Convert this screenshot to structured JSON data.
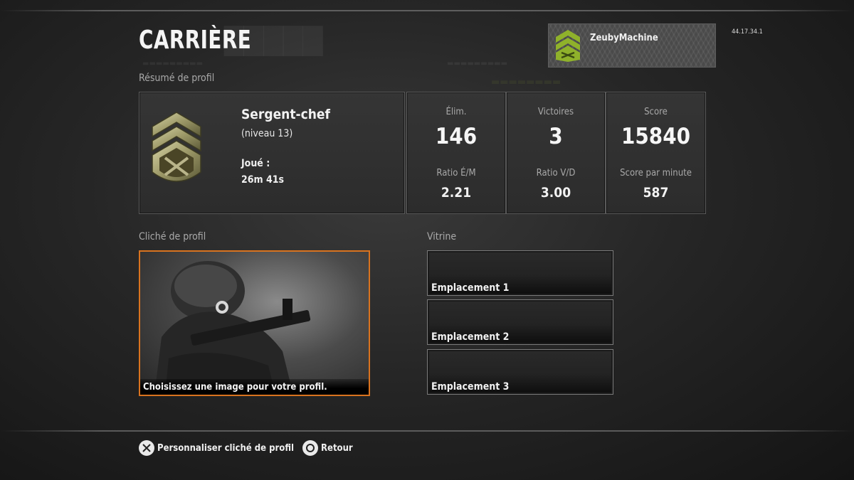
{
  "header": {
    "title": "CARRIÈRE",
    "version": "44.17.34.1"
  },
  "player": {
    "name": "ZeubyMachine",
    "emblem_icon": "sergeant-chevron-icon",
    "emblem_color": "#8fb12b"
  },
  "profile_summary": {
    "section_label": "Résumé de profil",
    "rank": {
      "icon": "staff-sergeant-rank-icon",
      "name": "Sergent-chef",
      "level": "(niveau 13)",
      "played_label": "Joué :",
      "played_value": "26m 41s"
    },
    "stats": [
      {
        "title": "Élim.",
        "value": "146",
        "sub_title": "Ratio É/M",
        "sub_value": "2.21"
      },
      {
        "title": "Victoires",
        "value": "3",
        "sub_title": "Ratio V/D",
        "sub_value": "3.00"
      },
      {
        "title": "Score",
        "value": "15840",
        "sub_title": "Score par minute",
        "sub_value": "587"
      }
    ]
  },
  "snapshot": {
    "section_label": "Cliché de profil",
    "caption": "Choisissez une image pour votre profil.",
    "highlight_color": "#d9731f"
  },
  "showcase": {
    "section_label": "Vitrine",
    "slots": [
      {
        "label": "Emplacement 1"
      },
      {
        "label": "Emplacement 2"
      },
      {
        "label": "Emplacement 3"
      }
    ]
  },
  "footer": {
    "hints": [
      {
        "icon": "cross-button-icon",
        "label": "Personnaliser cliché de profil"
      },
      {
        "icon": "circle-button-icon",
        "label": "Retour"
      }
    ]
  }
}
